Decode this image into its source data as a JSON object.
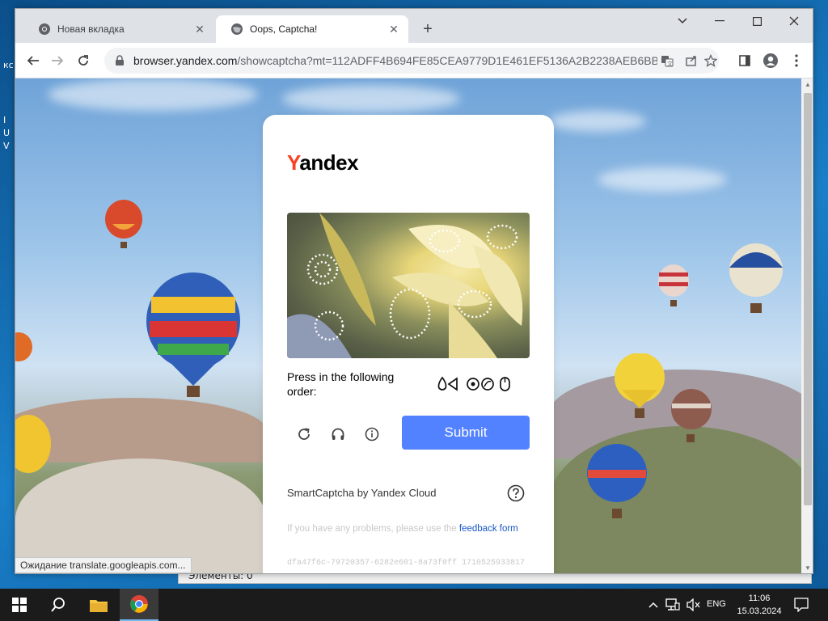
{
  "desktop": {
    "fragments": [
      "кс",
      "I",
      "U",
      "V"
    ],
    "behind_window_text": "Элементы: 0"
  },
  "browser": {
    "tabs": [
      {
        "label": "Новая вкладка",
        "icon": "chrome-icon"
      },
      {
        "label": "Oops, Captcha!",
        "icon": "globe-icon",
        "active": true
      }
    ],
    "new_tab_label": "+",
    "address": {
      "host": "browser.yandex.com",
      "path": "/showcaptcha?mt=112ADFF4B694FE85CEA9779D1E461EF5136A2B2238AEB6BBE..."
    },
    "status_text": "Ожидание translate.googleapis.com..."
  },
  "captcha": {
    "logo_first": "Y",
    "logo_rest": "andex",
    "instruction": "Press in the following order:",
    "order_icon_names": [
      "drop-icon",
      "triangle-icon",
      "target-icon",
      "leaf-icon",
      "mouse-icon"
    ],
    "submit_label": "Submit",
    "brand_text": "SmartCaptcha by Yandex Cloud",
    "feedback_text": "If you have any problems, please use the",
    "feedback_link": "feedback form",
    "request_id": "dfa47f6c-79720357-6282e601-8a73f0ff 1710525933817"
  },
  "taskbar": {
    "language": "ENG",
    "time": "11:06",
    "date": "15.03.2024"
  },
  "colors": {
    "submit": "#5282ff",
    "yandex_red": "#fc3f1d",
    "link": "#1a57c9",
    "taskbar": "#1b1b1b"
  }
}
